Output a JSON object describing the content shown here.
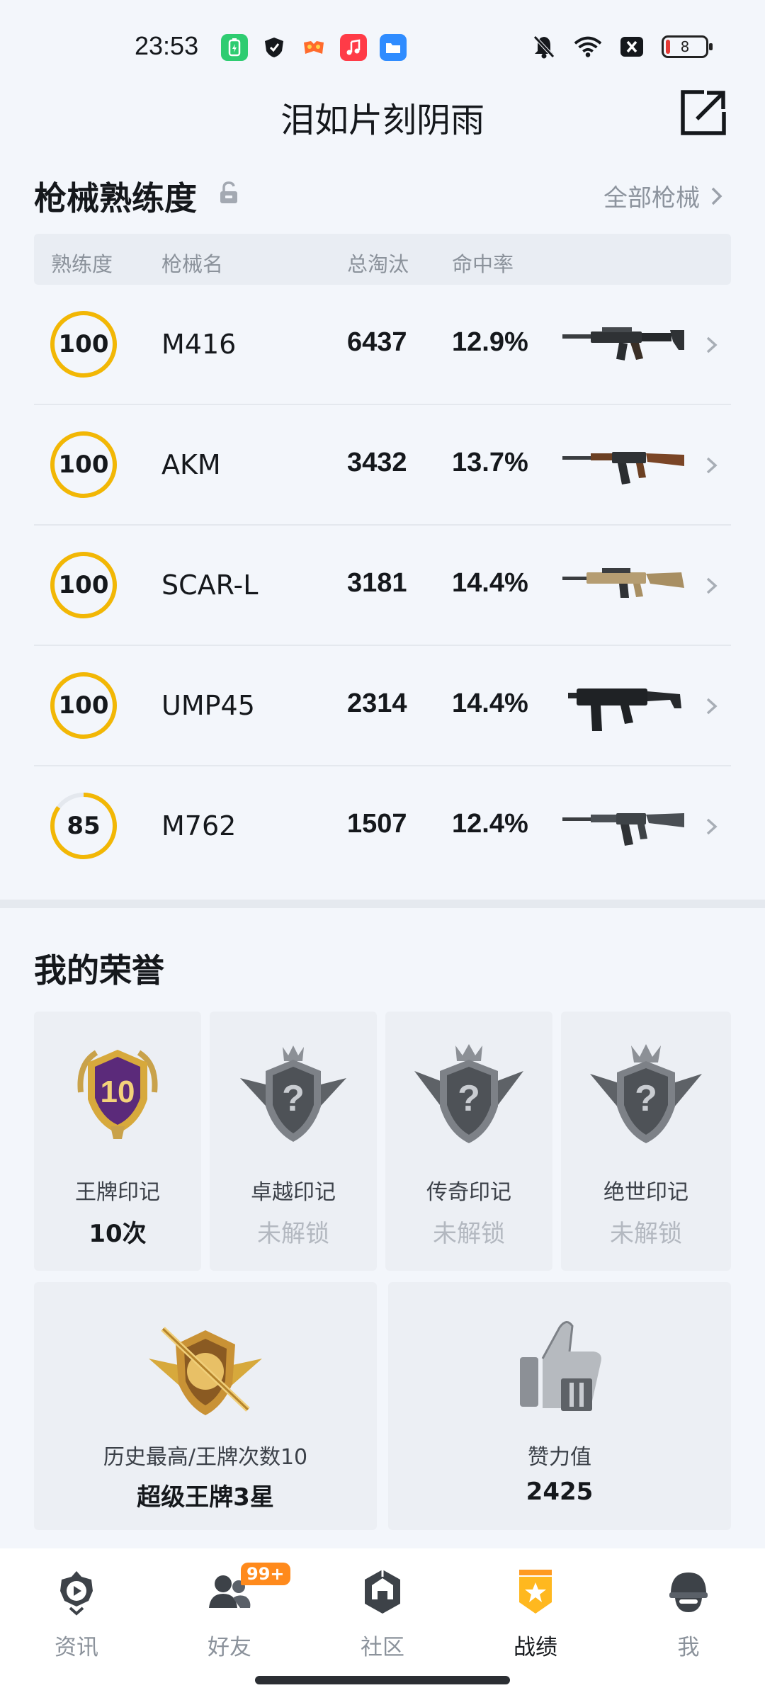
{
  "status_bar": {
    "time": "23:53",
    "battery_level": "8",
    "notification_icons": [
      "battery-saver-icon",
      "shield-icon",
      "game-icon",
      "music-icon",
      "file-manager-icon"
    ],
    "system_icons": [
      "mute-icon",
      "wifi-icon",
      "close-box-icon"
    ]
  },
  "header": {
    "title": "泪如片刻阴雨"
  },
  "mastery": {
    "title": "枪械熟练度",
    "all_weapons_label": "全部枪械",
    "columns": {
      "proficiency": "熟练度",
      "name": "枪械名",
      "kills": "总淘汰",
      "hit_rate": "命中率"
    },
    "weapons": [
      {
        "proficiency": "100",
        "progress": 1.0,
        "name": "M416",
        "kills": "6437",
        "hit_rate": "12.9%"
      },
      {
        "proficiency": "100",
        "progress": 1.0,
        "name": "AKM",
        "kills": "3432",
        "hit_rate": "13.7%"
      },
      {
        "proficiency": "100",
        "progress": 1.0,
        "name": "SCAR-L",
        "kills": "3181",
        "hit_rate": "14.4%"
      },
      {
        "proficiency": "100",
        "progress": 1.0,
        "name": "UMP45",
        "kills": "2314",
        "hit_rate": "14.4%"
      },
      {
        "proficiency": "85",
        "progress": 0.85,
        "name": "M762",
        "kills": "1507",
        "hit_rate": "12.4%"
      }
    ]
  },
  "honors": {
    "title": "我的荣誉",
    "marks": [
      {
        "label": "王牌印记",
        "value": "10次",
        "badge_number": "10",
        "locked": false
      },
      {
        "label": "卓越印记",
        "value": "未解锁",
        "locked": true
      },
      {
        "label": "传奇印记",
        "value": "未解锁",
        "locked": true
      },
      {
        "label": "绝世印记",
        "value": "未解锁",
        "locked": true
      }
    ],
    "best_rank": {
      "label": "历史最高/王牌次数10",
      "value": "超级王牌3星"
    },
    "likes": {
      "label": "赞力值",
      "value": "2425"
    }
  },
  "bottom_nav": {
    "items": [
      {
        "label": "资讯",
        "icon": "news-icon",
        "active": false
      },
      {
        "label": "好友",
        "icon": "friends-icon",
        "active": false,
        "badge": "99+"
      },
      {
        "label": "社区",
        "icon": "community-icon",
        "active": false
      },
      {
        "label": "战绩",
        "icon": "record-icon",
        "active": true
      },
      {
        "label": "我",
        "icon": "profile-icon",
        "active": false
      }
    ]
  },
  "colors": {
    "accent_gold": "#f2b705",
    "ring_track": "#e4e8ee",
    "badge_orange": "#ff8a1c"
  }
}
